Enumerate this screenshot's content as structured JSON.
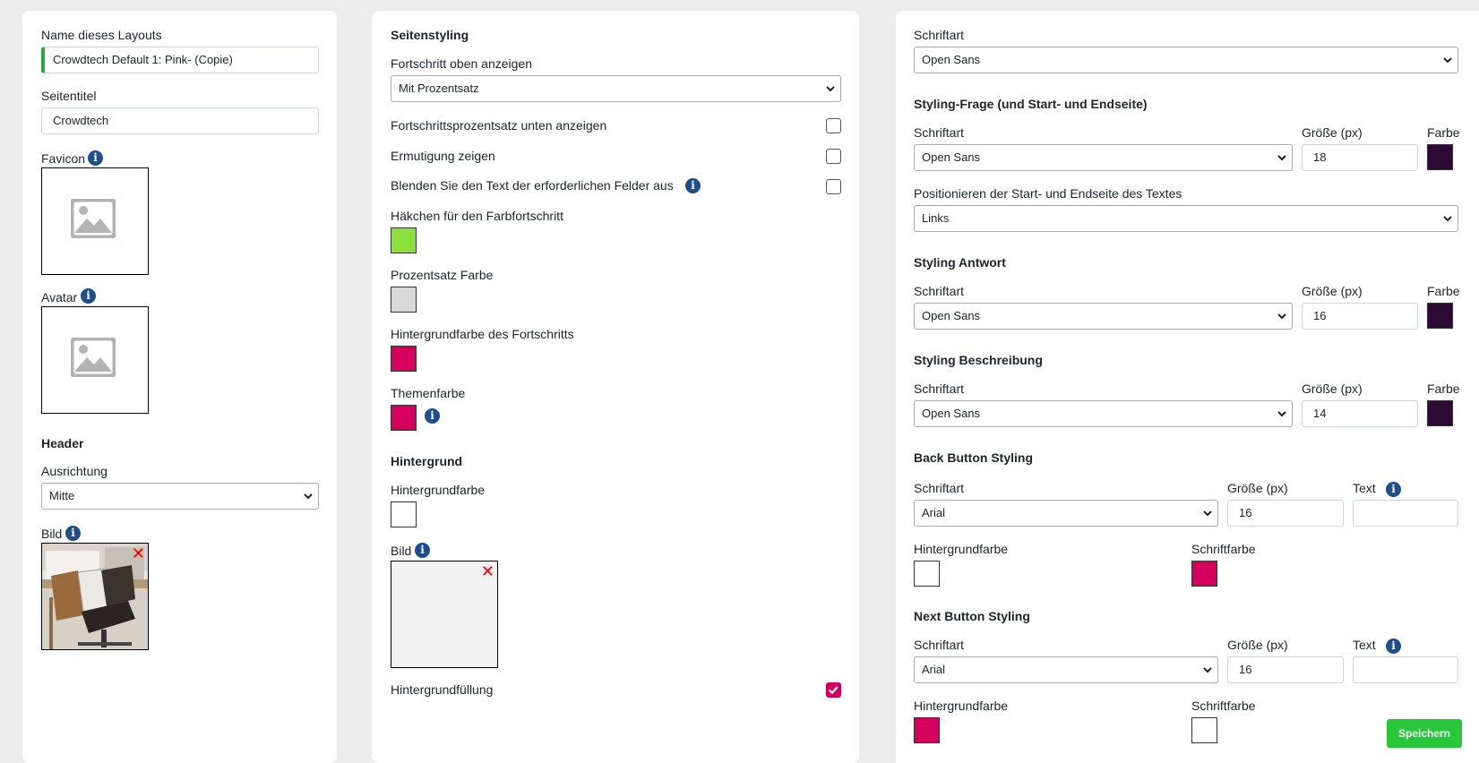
{
  "left": {
    "layout_name_label": "Name dieses Layouts",
    "layout_name_value": "Crowdtech Default 1: Pink- (Copie)",
    "page_title_label": "Seitentitel",
    "page_title_value": "Crowdtech",
    "favicon_label": "Favicon",
    "avatar_label": "Avatar",
    "header_heading": "Header",
    "alignment_label": "Ausrichtung",
    "alignment_value": "Mitte",
    "image_label": "Bild"
  },
  "middle": {
    "heading": "Seitenstyling",
    "progress_top_label": "Fortschritt oben anzeigen",
    "progress_top_value": "Mit Prozentsatz",
    "progress_percent_bottom_label": "Fortschrittsprozentsatz unten anzeigen",
    "encouragement_label": "Ermutigung zeigen",
    "hide_required_text_label": "Blenden Sie den Text der erforderlichen Felder aus",
    "tick_color_label": "Häkchen für den Farbfortschritt",
    "percent_color_label": "Prozentsatz Farbe",
    "progress_bg_color_label": "Hintergrundfarbe des Fortschritts",
    "theme_color_label": "Themenfarbe",
    "background_heading": "Hintergrund",
    "bg_color_label": "Hintergrundfarbe",
    "bg_image_label": "Bild",
    "bg_fill_label": "Hintergrundfüllung",
    "checkboxes": {
      "progress_percent_bottom": false,
      "encouragement": false,
      "hide_required_text": false,
      "bg_fill": true
    },
    "colors": {
      "tick": "#8ce03c",
      "percent": "#d9d9d9",
      "progress_bg": "#d5005d",
      "theme": "#d5005d",
      "background": "#ffffff"
    }
  },
  "right": {
    "font_label": "Schriftart",
    "font_value": "Open Sans",
    "question_heading": "Styling-Frage (und Start- und Endseite)",
    "size_label": "Größe (px)",
    "color_label": "Farbe",
    "text_label": "Text",
    "question_font": "Open Sans",
    "question_size": "18",
    "position_label": "Positionieren der Start- und Endseite des Textes",
    "position_value": "Links",
    "answer_heading": "Styling Antwort",
    "answer_font": "Open Sans",
    "answer_size": "16",
    "description_heading": "Styling Beschreibung",
    "description_font": "Open Sans",
    "description_size": "14",
    "back_heading": "Back Button Styling",
    "back_font": "Arial",
    "back_size": "16",
    "bg_color_label": "Hintergrundfarbe",
    "font_color_label": "Schriftfarbe",
    "next_heading": "Next Button Styling",
    "next_font": "Arial",
    "next_size": "16",
    "colors": {
      "dark": "#2d0a33",
      "pink": "#d5005d",
      "white": "#ffffff"
    }
  },
  "save_label": "Speichern"
}
